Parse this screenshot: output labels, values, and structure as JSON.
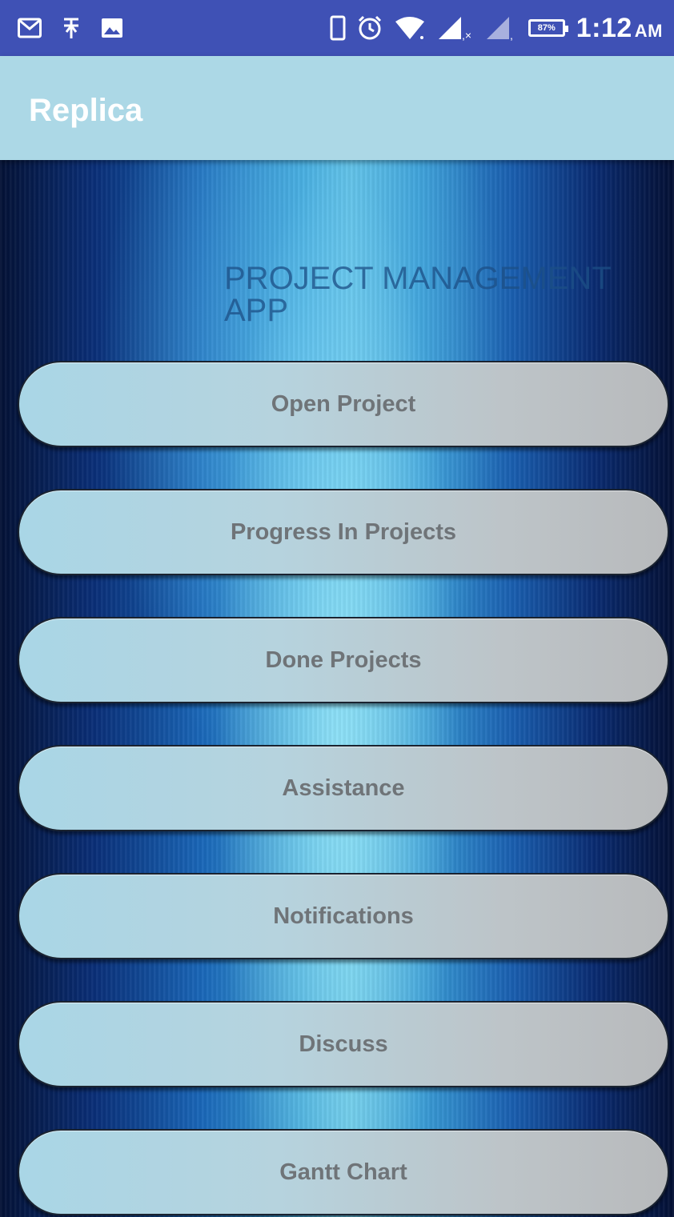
{
  "status_bar": {
    "time": "1:12",
    "ampm": "AM",
    "battery": "87%",
    "left_icons": [
      "gmail-icon",
      "usb-debug-icon",
      "image-icon"
    ],
    "right_icons": [
      "phone-outline-icon",
      "alarm-icon",
      "wifi-icon",
      "signal-icon",
      "signal-x-icon",
      "battery-icon"
    ]
  },
  "app_bar": {
    "title": "Replica",
    "background": "#acd8e6"
  },
  "headline": "PROJECT MANAGEMENT APP",
  "menu": [
    {
      "label": "Open Project"
    },
    {
      "label": "Progress In Projects"
    },
    {
      "label": "Done Projects"
    },
    {
      "label": "Assistance"
    },
    {
      "label": "Notifications"
    },
    {
      "label": "Discuss"
    },
    {
      "label": "Gantt Chart"
    }
  ],
  "colors": {
    "status_bar": "#3f51b5",
    "button_text": "#6f7478"
  }
}
